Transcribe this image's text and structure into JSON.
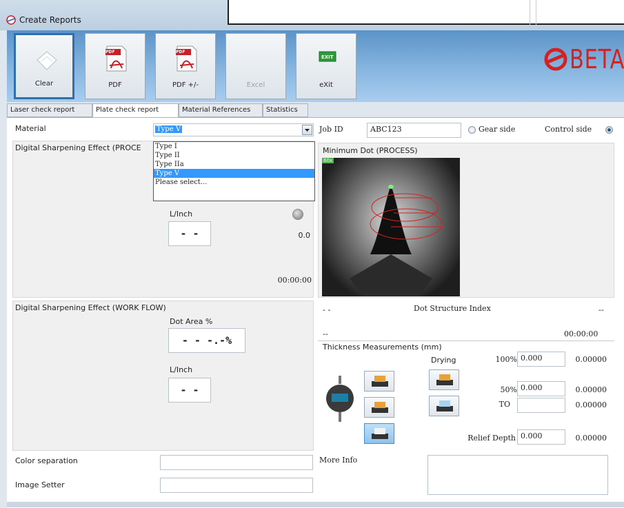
{
  "window": {
    "title": "Create Reports"
  },
  "toolbar": {
    "buttons": [
      {
        "label": "Clear",
        "icon": "eraser-icon"
      },
      {
        "label": "PDF",
        "icon": "pdf-icon"
      },
      {
        "label": "PDF +/-",
        "icon": "pdf-plus-minus-icon"
      },
      {
        "label": "Excel",
        "icon": "excel-icon"
      },
      {
        "label": "eXit",
        "icon": "exit-icon"
      }
    ],
    "exit_badge": "EXIT",
    "pdf_badge": "PDF"
  },
  "logo": {
    "text": "BETA"
  },
  "tabs": [
    "Laser check report",
    "Plate check report",
    "Material References",
    "Statistics"
  ],
  "material": {
    "label": "Material",
    "value": "Type V",
    "options": [
      "Type I",
      "Type II",
      "Type IIa",
      "Type V",
      "Please select..."
    ]
  },
  "job": {
    "label": "Job ID",
    "value": "ABC123",
    "gear_side": "Gear side",
    "control_side": "Control side"
  },
  "dse_process": {
    "title": "Digital Sharpening Effect (PROCE",
    "linch_label": "L/Inch",
    "linch_value": "- -",
    "value": "0.0",
    "time": "00:00:00"
  },
  "dse_workflow": {
    "title": "Digital Sharpening Effect (WORK FLOW)",
    "dot_area_label": "Dot Area %",
    "dot_area_value": "- - -.-%",
    "linch_label": "L/Inch",
    "linch_value": "- -"
  },
  "min_dot": {
    "title": "Minimum Dot (PROCESS)",
    "badge": "60x",
    "left_value": "- -",
    "index_label": "Dot Structure Index",
    "right_value": "--",
    "bottom_left": "--",
    "time": "00:00:00"
  },
  "thickness": {
    "title": "Thickness Measurements (mm)",
    "drying": "Drying",
    "p100_label": "100%",
    "p100_value": "0.000",
    "p100_result": "0.00000",
    "p50_label": "50%",
    "p50_value": "0.000",
    "p50_result": "0.00000",
    "to_label": "TO",
    "to_value": "",
    "to_result": "0.00000",
    "relief_label": "Relief Depth",
    "relief_value": "0.000",
    "relief_result": "0.00000"
  },
  "bottom": {
    "color_separation": "Color separation",
    "image_setter": "Image Setter",
    "more_info": "More Info"
  },
  "colors": {
    "accent": "#3399ff",
    "toolbar": "#6fa3d6",
    "logo": "#d42222"
  }
}
